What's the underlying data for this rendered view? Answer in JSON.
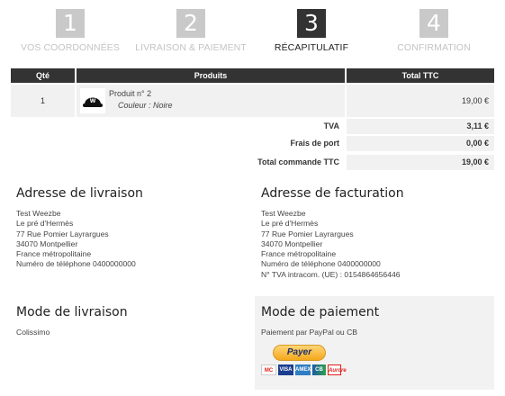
{
  "steps": [
    {
      "num": "1",
      "label": "VOS COORDONNÉES"
    },
    {
      "num": "2",
      "label": "LIVRAISON & PAIEMENT"
    },
    {
      "num": "3",
      "label": "RÉCAPITULATIF"
    },
    {
      "num": "4",
      "label": "CONFIRMATION"
    }
  ],
  "table": {
    "headers": {
      "qty": "Qté",
      "products": "Produits",
      "total": "Total TTC"
    },
    "items": [
      {
        "qty": "1",
        "name": "Produit n° 2",
        "variant": "Couleur : Noire",
        "price": "19,00 €"
      }
    ],
    "summary": [
      {
        "label": "TVA",
        "value": "3,11 €"
      },
      {
        "label": "Frais de port",
        "value": "0,00 €"
      },
      {
        "label": "Total commande TTC",
        "value": "19,00 €"
      }
    ]
  },
  "delivery_address": {
    "title": "Adresse de livraison",
    "lines": [
      "Test Weezbe",
      "Le pré d'Hermès",
      "77 Rue Pomier Layrargues",
      "34070 Montpellier",
      "France métropolitaine",
      "Numéro de téléphone 0400000000"
    ]
  },
  "billing_address": {
    "title": "Adresse de facturation",
    "lines": [
      "Test Weezbe",
      "Le pré d'Hermès",
      "77 Rue Pomier Layrargues",
      "34070 Montpellier",
      "France métropolitaine",
      "Numéro de téléphone 0400000000",
      "N° TVA intracom. (UE) : 0154864656446"
    ]
  },
  "delivery_mode": {
    "title": "Mode de livraison",
    "value": "Colissimo"
  },
  "payment_mode": {
    "title": "Mode de paiement",
    "value": "Paiement par PayPal ou CB",
    "button": "Payer",
    "cards": [
      "MC",
      "VISA",
      "AMEX",
      "CB",
      "Aurore"
    ]
  },
  "colors": {
    "dark": "#333333",
    "inactive_step": "#c9c9c9",
    "row_bg": "#f1f1f1",
    "paypal": "#f4a81b"
  }
}
